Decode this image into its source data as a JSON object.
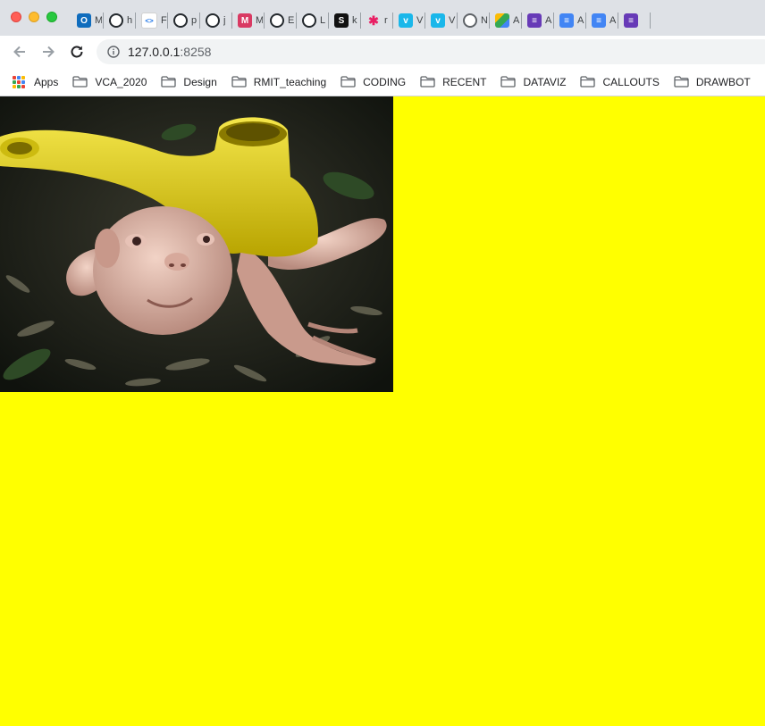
{
  "browser": {
    "tabs": [
      {
        "icon": "outlook-icon",
        "title": "M",
        "color": "#0f6cbd",
        "glyph": "O"
      },
      {
        "icon": "github-icon",
        "title": "h",
        "color": "#24292e",
        "glyph": ""
      },
      {
        "icon": "code-icon",
        "title": "F",
        "color": "#ffffff",
        "glyph": "<>"
      },
      {
        "icon": "github-icon",
        "title": "p",
        "color": "#24292e",
        "glyph": ""
      },
      {
        "icon": "github-icon",
        "title": "j",
        "color": "#24292e",
        "glyph": ""
      },
      {
        "icon": "medium-icon",
        "title": "M",
        "color": "#d93a63",
        "glyph": "M"
      },
      {
        "icon": "github-icon",
        "title": "E",
        "color": "#24292e",
        "glyph": ""
      },
      {
        "icon": "github-icon",
        "title": "L",
        "color": "#24292e",
        "glyph": ""
      },
      {
        "icon": "s-app-icon",
        "title": "k",
        "color": "#111111",
        "glyph": "S"
      },
      {
        "icon": "asterisk-icon",
        "title": "r",
        "color": "#e91e63",
        "glyph": "✱"
      },
      {
        "icon": "vimeo-icon",
        "title": "V",
        "color": "#1ab7ea",
        "glyph": "v"
      },
      {
        "icon": "vimeo-icon",
        "title": "V",
        "color": "#1ab7ea",
        "glyph": "v"
      },
      {
        "icon": "chrome-icon",
        "title": "N",
        "color": "#5f6368",
        "glyph": ""
      },
      {
        "icon": "drive-icon",
        "title": "A",
        "color": "#34a853",
        "glyph": ""
      },
      {
        "icon": "forms-icon",
        "title": "A",
        "color": "#673ab7",
        "glyph": "≡"
      },
      {
        "icon": "docs-icon",
        "title": "A",
        "color": "#4285f4",
        "glyph": "≡"
      },
      {
        "icon": "docs-icon",
        "title": "A",
        "color": "#4285f4",
        "glyph": "≡"
      },
      {
        "icon": "forms-icon",
        "title": "",
        "color": "#673ab7",
        "glyph": "≡"
      }
    ],
    "address": {
      "host": "127.0.0.1",
      "port": ":8258"
    },
    "bookmarks": {
      "apps_label": "Apps",
      "folders": [
        "VCA_2020",
        "Design",
        "RMIT_teaching",
        "CODING",
        "RECENT",
        "DATAVIZ",
        "CALLOUTS",
        "DRAWBOT"
      ]
    }
  },
  "page": {
    "background": "#ffff00",
    "image_alt": "Creature wearing yellow watering can"
  }
}
